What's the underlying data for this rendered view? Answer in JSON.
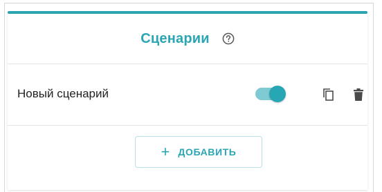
{
  "panel": {
    "title": "Сценарии",
    "help_icon": "help-circle-icon"
  },
  "scenarios": [
    {
      "name": "Новый сценарий",
      "enabled": true,
      "actions": [
        "copy-icon",
        "trash-icon"
      ]
    }
  ],
  "add_button": {
    "icon": "plus-icon",
    "label": "ДОБАВИТЬ"
  },
  "colors": {
    "accent": "#2aa5b3",
    "toggle_track": "#7fcbd3",
    "text": "#222222",
    "icon": "#4a4a4a"
  }
}
